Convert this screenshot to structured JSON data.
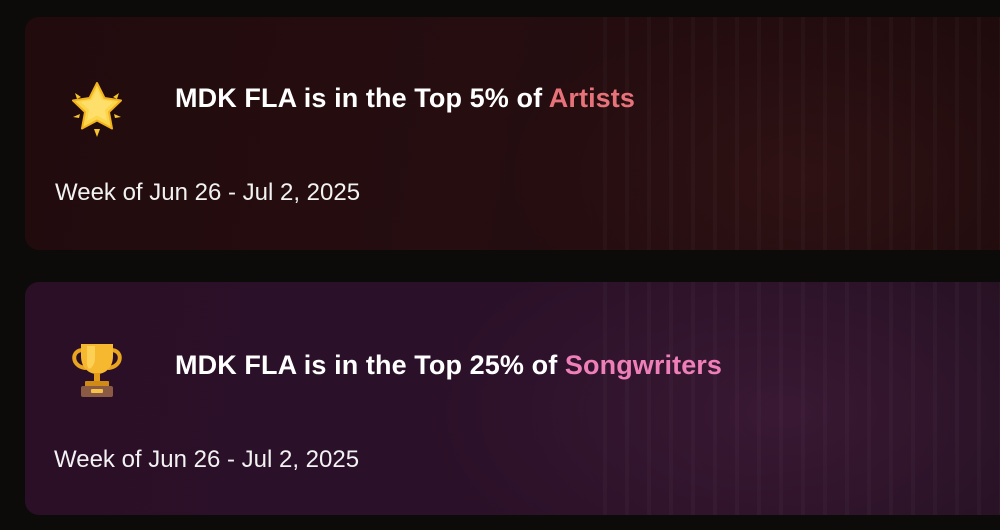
{
  "cards": [
    {
      "icon": "glowing-star-icon",
      "title_prefix": "MDK FLA is in the Top 5% of ",
      "category": "Artists",
      "date_range": "Week of Jun 26 - Jul 2, 2025",
      "accent_color": "#e8727a"
    },
    {
      "icon": "trophy-icon",
      "title_prefix": "MDK FLA is in the Top 25% of ",
      "category": "Songwriters",
      "date_range": "Week of Jun 26 - Jul 2, 2025",
      "accent_color": "#ee7fb8"
    }
  ]
}
